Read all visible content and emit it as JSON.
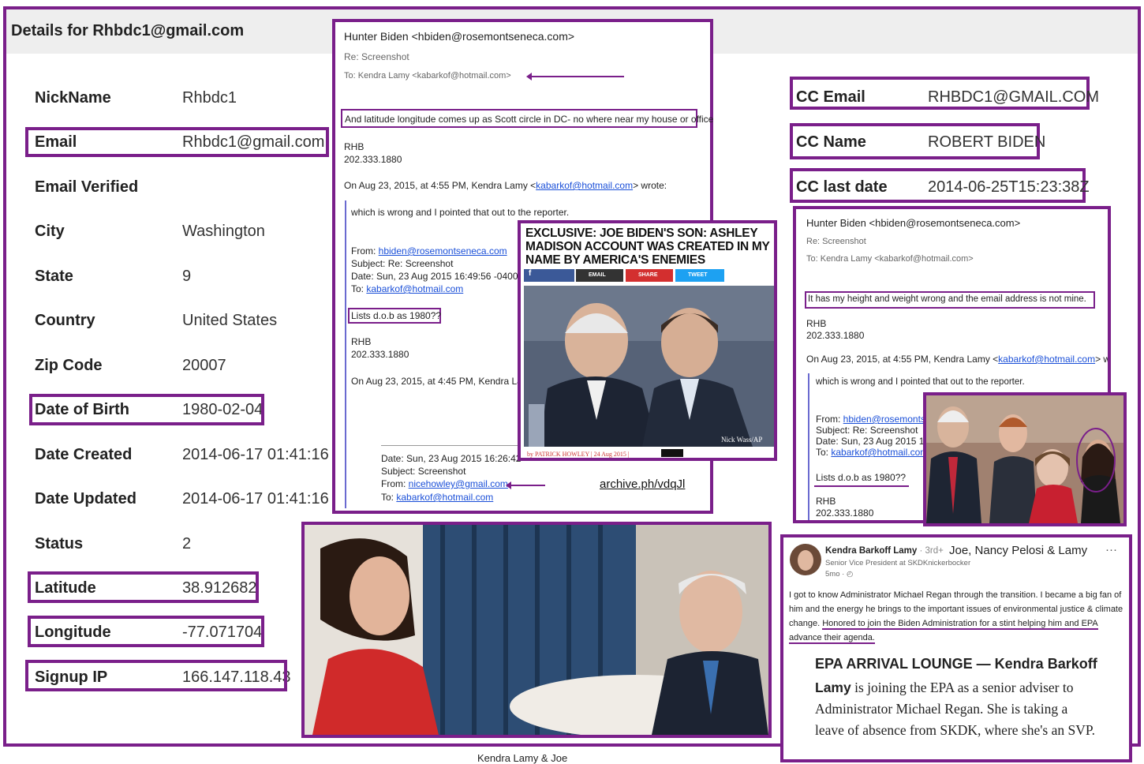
{
  "details": {
    "title": "Details for Rhbdc1@gmail.com",
    "rows": [
      {
        "label": "NickName",
        "value": "Rhbdc1"
      },
      {
        "label": "Email",
        "value": "Rhbdc1@gmail.com"
      },
      {
        "label": "Email Verified",
        "value": ""
      },
      {
        "label": "City",
        "value": "Washington"
      },
      {
        "label": "State",
        "value": "9"
      },
      {
        "label": "Country",
        "value": "United States"
      },
      {
        "label": "Zip Code",
        "value": "20007"
      },
      {
        "label": "Date of Birth",
        "value": "1980-02-04"
      },
      {
        "label": "Date Created",
        "value": "2014-06-17 01:41:16"
      },
      {
        "label": "Date Updated",
        "value": "2014-06-17 01:41:16"
      },
      {
        "label": "Status",
        "value": "2"
      },
      {
        "label": "Latitude",
        "value": "38.912682"
      },
      {
        "label": "Longitude",
        "value": "-77.071704"
      },
      {
        "label": "Signup IP",
        "value": "166.147.118.43"
      }
    ]
  },
  "email1": {
    "from": "Hunter Biden <hbiden@rosemontseneca.com>",
    "subject": "Re: Screenshot",
    "to": "To: Kendra Lamy <kabarkof@hotmail.com>",
    "quote": "And latitude longitude comes up as Scott circle in DC- no where near my house or office",
    "sig1": "RHB",
    "sig2": "202.333.1880",
    "wrote_prefix": "On Aug 23, 2015, at 4:55 PM, Kendra Lamy <",
    "wrote_link": "kabarkof@hotmail.com",
    "wrote_suffix": "> wrote:",
    "wrong": "which is wrong and I pointed that out to the reporter.",
    "from2_label": "From: ",
    "from2_link": "hbiden@rosemontseneca.com",
    "subject2": "Subject: Re: Screenshot",
    "date2": "Date: Sun, 23 Aug 2015 16:49:56 -0400",
    "to2_label": "To: ",
    "to2_link": "kabarkof@hotmail.com",
    "dob": "Lists d.o.b as 1980??",
    "sig3": "RHB",
    "sig4": "202.333.1880",
    "wrote2": "On Aug 23, 2015, at 4:45 PM, Kendra Lam",
    "date3": "Date: Sun, 23 Aug 2015 16:26:42",
    "subject3": "Subject: Screenshot",
    "from3_label": "From: ",
    "from3_link": "nicehowley@gmail.com",
    "to3_label": "To: ",
    "to3_link": "kabarkof@hotmail.com",
    "archive": "archive.ph/vdqJl"
  },
  "article": {
    "headline": "EXCLUSIVE: JOE BIDEN'S SON: ASHLEY MADISON ACCOUNT WAS CREATED IN MY NAME BY AMERICA'S ENEMIES",
    "share1": "f",
    "share2": "EMAIL",
    "share3": "SHARE",
    "share4": "TWEET",
    "byline": "by PATRICK HOWLEY | 24 Aug 2015 |",
    "credit": "Nick Wass/AP",
    "colors": {
      "fb": "#3b5998",
      "email": "#333333",
      "share": "#d32f2f",
      "tweet": "#1da1f2"
    }
  },
  "cc": {
    "email_label": "CC Email",
    "email_value": "RHBDC1@GMAIL.COM",
    "name_label": "CC Name",
    "name_value": "ROBERT BIDEN",
    "date_label": "CC last date",
    "date_value": "2014-06-25T15:23:38Z"
  },
  "email2": {
    "from": "Hunter Biden <hbiden@rosemontseneca.com>",
    "subject": "Re: Screenshot",
    "to": "To: Kendra Lamy <kabarkof@hotmail.com>",
    "quote": "It has my height and weight wrong and the email address is not mine.",
    "sig1": "RHB",
    "sig2": "202.333.1880",
    "wrote_prefix": "On Aug 23, 2015, at 4:55 PM, Kendra Lamy <",
    "wrote_link": "kabarkof@hotmail.com",
    "wrote_suffix": "> wr",
    "wrong": "which is wrong and I pointed that out to the reporter.",
    "from2_label": "From: ",
    "from2_link": "hbiden@rosemontse",
    "subject2": "Subject: Re: Screenshot",
    "date2": "Date: Sun, 23 Aug 2015 16",
    "to2_label": "To: ",
    "to2_link": "kabarkof@hotmail.com",
    "dob": "Lists d.o.b as 1980??",
    "sig3": "RHB",
    "sig4": "202.333.1880"
  },
  "linkedin": {
    "name": "Kendra Barkoff Lamy",
    "degree": " · 3rd+",
    "caption": "Joe, Nancy Pelosi & Lamy",
    "more": "···",
    "title": "Senior Vice President at SKDKnickerbocker",
    "time": "5mo · ",
    "post_plain": "I got to know Administrator Michael Regan through the transition. I became a big fan of him and the energy he brings to the important issues of environmental justice & climate change. ",
    "post_underlined": "Honored to join the Biden Administration for a stint helping him and EPA advance their agenda.",
    "news_head": "EPA ARRIVAL LOUNGE — Kendra Barkoff",
    "news_bold": "Lamy",
    "news_body": " is joining the EPA as a senior adviser to Administrator Michael Regan. She is taking a leave of absence from SKDK, where she's an SVP."
  },
  "photo_caption": "Kendra Lamy & Joe",
  "accent": "#7a1f8a"
}
